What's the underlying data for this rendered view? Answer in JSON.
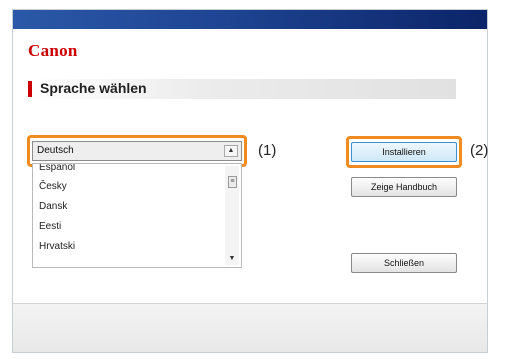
{
  "app": {
    "brand": "Canon",
    "heading": "Sprache wählen"
  },
  "language_select": {
    "value": "Deutsch",
    "list": [
      "Español",
      "Česky",
      "Dansk",
      "Eesti",
      "Hrvatski"
    ]
  },
  "buttons": {
    "install": "Installieren",
    "manual": "Zeige Handbuch",
    "close": "Schließen"
  },
  "callouts": {
    "one": "(1)",
    "two": "(2)"
  },
  "colors": {
    "brand": "#cc0000",
    "highlight": "#f08c1f",
    "titlebar": "#1e4492"
  }
}
